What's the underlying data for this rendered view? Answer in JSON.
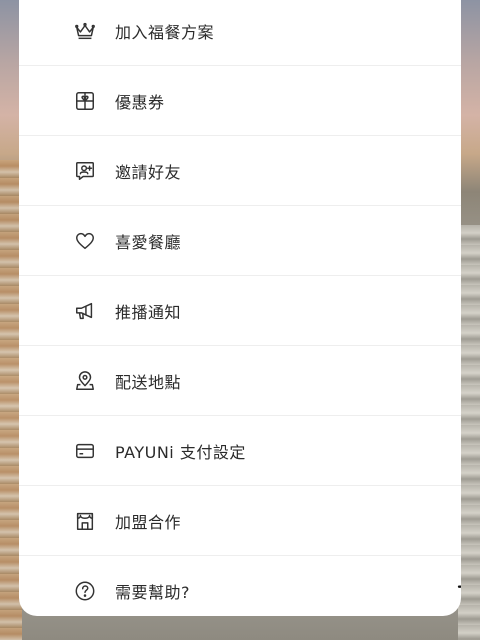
{
  "menu": {
    "items": [
      {
        "label": "加入福餐方案",
        "icon": "crown-icon"
      },
      {
        "label": "優惠券",
        "icon": "gift-coupon-icon"
      },
      {
        "label": "邀請好友",
        "icon": "invite-friend-icon"
      },
      {
        "label": "喜愛餐廳",
        "icon": "heart-icon"
      },
      {
        "label": "推播通知",
        "icon": "megaphone-icon"
      },
      {
        "label": "配送地點",
        "icon": "location-pin-icon"
      },
      {
        "label": "PAYUNi 支付設定",
        "icon": "credit-card-icon"
      },
      {
        "label": "加盟合作",
        "icon": "storefront-icon"
      },
      {
        "label": "需要幫助?",
        "icon": "help-circle-icon"
      }
    ]
  }
}
